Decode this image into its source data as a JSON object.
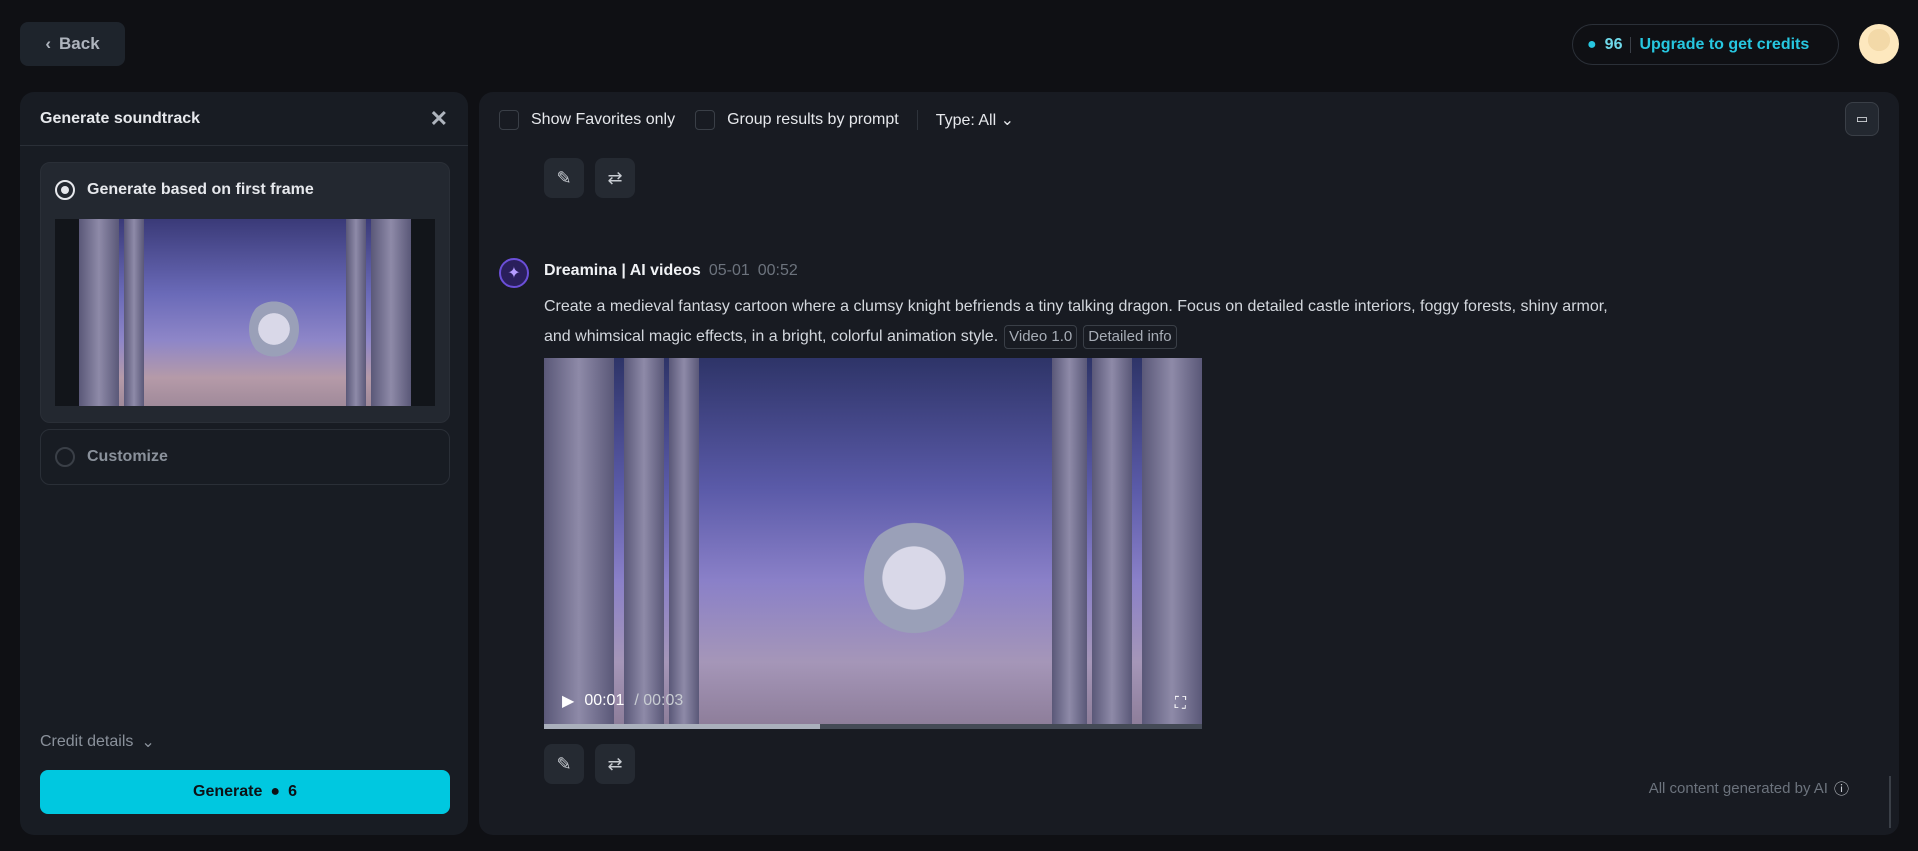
{
  "header": {
    "back_label": "Back",
    "credits": "96",
    "upgrade_label": "Upgrade to get credits"
  },
  "left_panel": {
    "title": "Generate soundtrack",
    "option_first_frame": "Generate based on first frame",
    "option_customize": "Customize",
    "credit_details": "Credit details",
    "generate_label": "Generate",
    "generate_cost": "6"
  },
  "toolbar": {
    "show_favorites": "Show Favorites only",
    "group_results": "Group results by prompt",
    "type_filter": "Type: All"
  },
  "message": {
    "author": "Dreamina | AI videos",
    "date": "05-01",
    "time": "00:52",
    "prompt": "Create a medieval fantasy cartoon where a clumsy knight befriends a tiny talking dragon. Focus on detailed castle interiors, foggy forests, shiny armor, and whimsical magic effects, in a bright, colorful animation style.",
    "tags": [
      "Video 1.0",
      "Detailed info"
    ]
  },
  "video": {
    "current_time": "00:01",
    "duration": "/ 00:03",
    "progress": 0.42
  },
  "footer": {
    "ai_notice": "All content generated by AI"
  },
  "colors": {
    "accent": "#00c8e0",
    "credit_text": "#27c7e0"
  }
}
